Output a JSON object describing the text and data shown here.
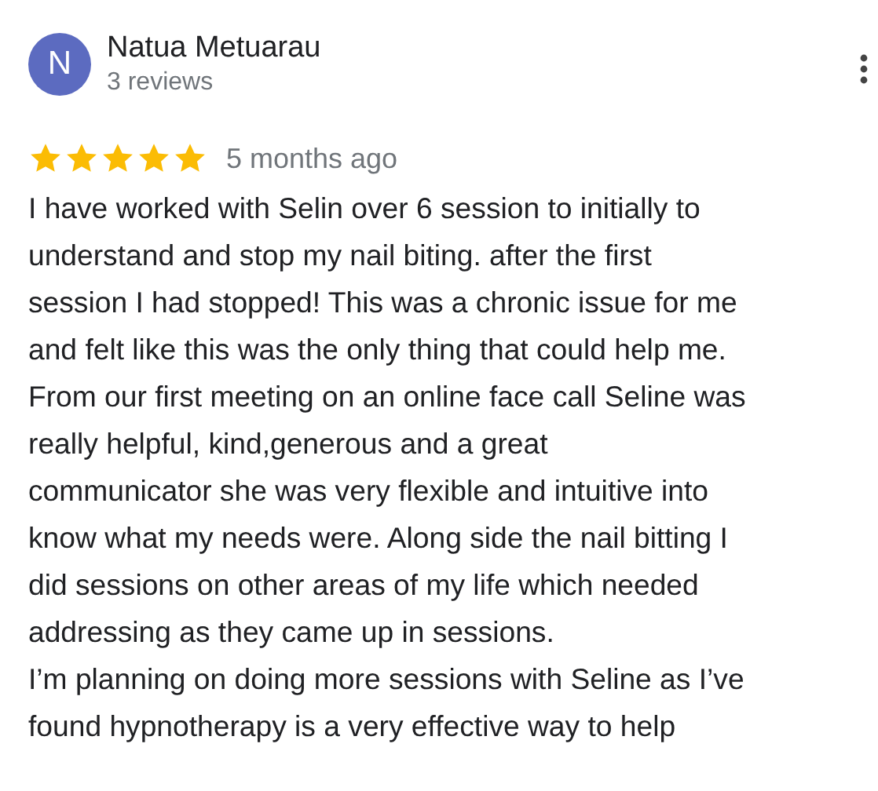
{
  "reviewer": {
    "initial": "N",
    "name": "Natua Metuarau",
    "reviews": "3 reviews"
  },
  "review": {
    "stars": 5,
    "time": "5 months ago",
    "paragraphs": [
      "I have worked with Selin over 6 session to initially to\nunderstand and stop my nail biting. after the first\nsession I had stopped! This was a chronic issue for me\nand felt like this was the only thing that could help me.\nFrom our first meeting on an online face call Seline was\nreally helpful, kind,generous and a great\ncommunicator she was very flexible and intuitive into\nknow what my needs were. Along side the nail bitting I\ndid sessions on other areas of my life which needed\naddressing as they came up in sessions.",
      "I’m planning on doing more sessions with Seline as I’ve\nfound hypnotherapy is a very effective way to help"
    ]
  }
}
